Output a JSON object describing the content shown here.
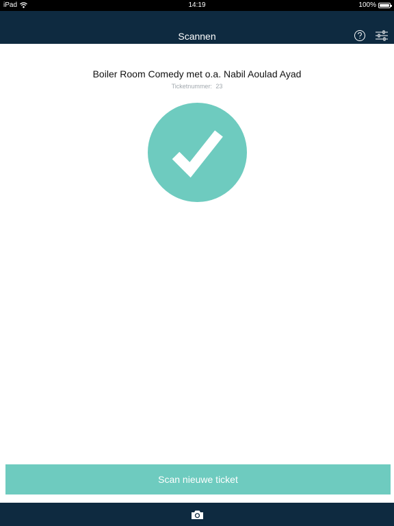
{
  "status_bar": {
    "device": "iPad",
    "time": "14:19",
    "battery": "100%",
    "wifi_icon": "wifi-icon",
    "battery_icon": "battery-icon"
  },
  "nav": {
    "title": "Scannen",
    "help_icon": "question-circle-icon",
    "settings_icon": "sliders-icon"
  },
  "result": {
    "event_title": "Boiler Room Comedy met o.a. Nabil Aoulad Ayad",
    "ticket_label": "Ticketnummer:",
    "ticket_number": "23",
    "status_icon": "checkmark-icon",
    "status_color": "#6ecbbf"
  },
  "action": {
    "scan_label": "Scan nieuwe ticket"
  },
  "footer": {
    "camera_icon": "camera-icon"
  },
  "colors": {
    "nav_background": "#0e2a40",
    "accent": "#6ecbbf"
  }
}
